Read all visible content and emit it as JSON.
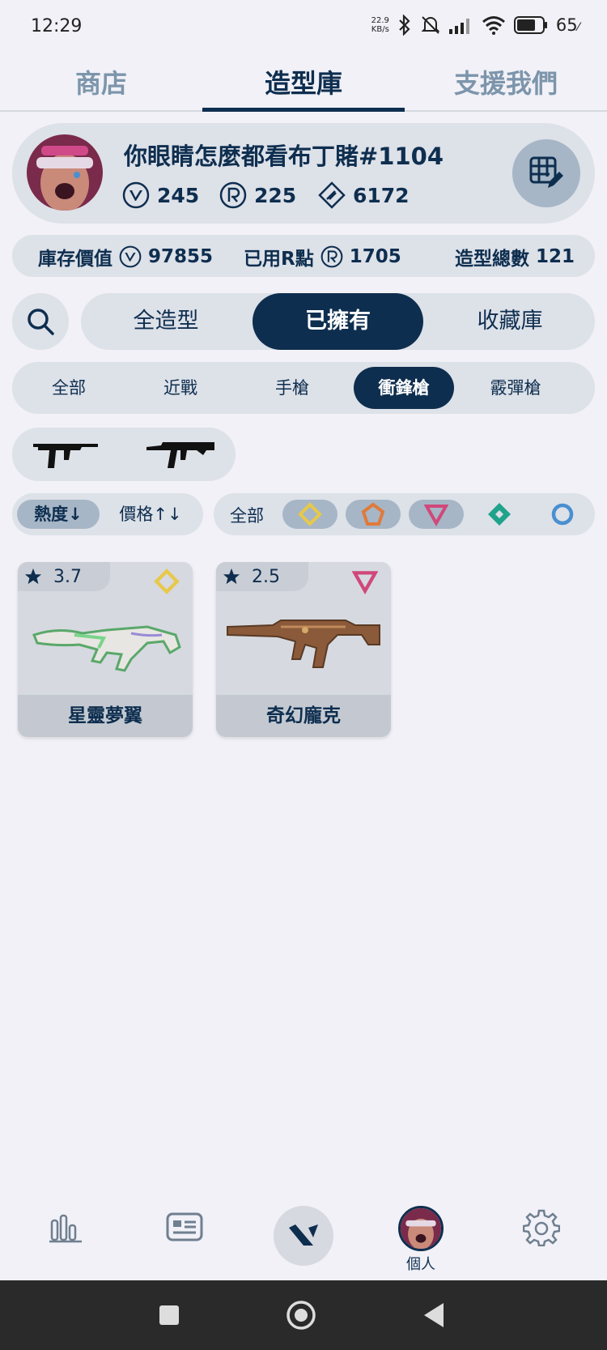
{
  "status_bar": {
    "time": "12:29",
    "net_speed_value": "22.9",
    "net_speed_unit": "KB/s",
    "battery": "65"
  },
  "top_tabs": [
    {
      "label": "商店"
    },
    {
      "label": "造型庫"
    },
    {
      "label": "支援我們"
    }
  ],
  "profile": {
    "username": "你眼睛怎麼都看布丁賭#1104",
    "valorant_points": "245",
    "radianite_points": "225",
    "kingdom_credits": "6172"
  },
  "stats": {
    "inventory_value_label": "庫存價值",
    "inventory_value": "97855",
    "used_r_label": "已用R點",
    "used_r_value": "1705",
    "total_skins_label": "造型總數",
    "total_skins_value": "121"
  },
  "filter_tabs": [
    {
      "label": "全造型"
    },
    {
      "label": "已擁有",
      "active": true
    },
    {
      "label": "收藏庫"
    }
  ],
  "category_tabs": [
    {
      "label": "全部"
    },
    {
      "label": "近戰"
    },
    {
      "label": "手槍"
    },
    {
      "label": "衝鋒槍",
      "active": true
    },
    {
      "label": "霰彈槍"
    }
  ],
  "weapon_types": [
    {
      "icon": "stinger-icon"
    },
    {
      "icon": "spectre-icon"
    }
  ],
  "sort": {
    "popularity_label": "熱度↓",
    "price_label": "價格↑↓"
  },
  "tier_filter": {
    "all_label": "全部",
    "tiers": [
      {
        "name": "exclusive",
        "color": "#e8c84a"
      },
      {
        "name": "ultra",
        "color": "#e07a3a"
      },
      {
        "name": "premium",
        "color": "#d0487a"
      },
      {
        "name": "deluxe",
        "color": "#1fa38a"
      },
      {
        "name": "select",
        "color": "#4a8fd0"
      }
    ]
  },
  "skins": [
    {
      "rating": "3.7",
      "name": "星靈夢翼",
      "tier_color": "#e8c84a"
    },
    {
      "rating": "2.5",
      "name": "奇幻龐克",
      "tier_color": "#d0487a"
    }
  ],
  "bottom_nav": {
    "profile_label": "個人"
  },
  "colors": {
    "primary": "#0e2e4f",
    "surface": "#dde1e8",
    "background": "#f1f1f7"
  }
}
